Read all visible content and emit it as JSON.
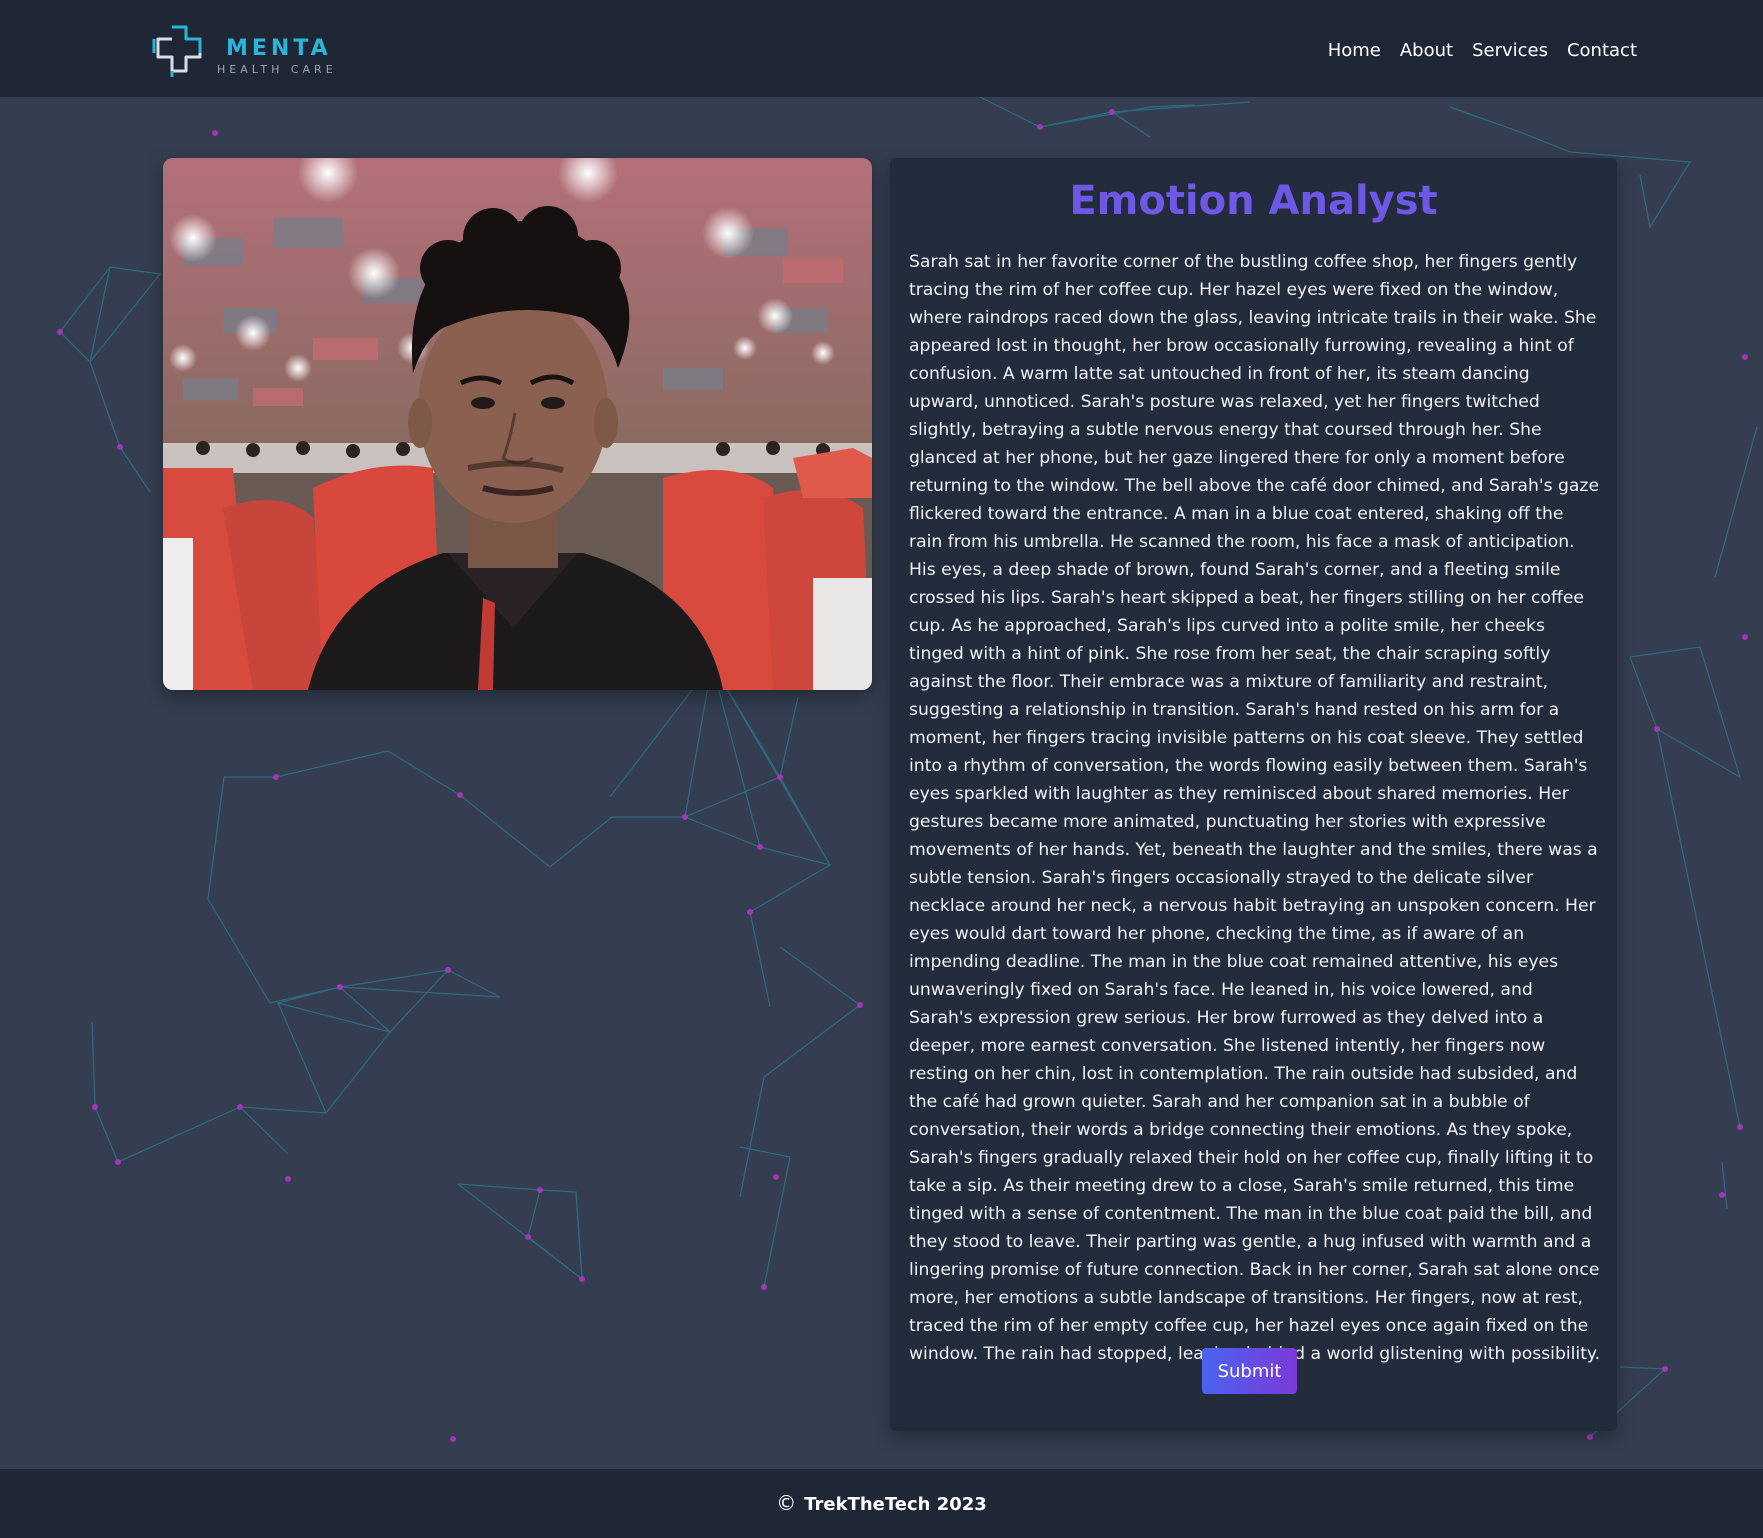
{
  "header": {
    "logo": {
      "title": "MENTA",
      "subtitle": "HEALTH CARE",
      "icon": "medical-cross-icon"
    },
    "nav": [
      {
        "label": "Home"
      },
      {
        "label": "About"
      },
      {
        "label": "Services"
      },
      {
        "label": "Contact"
      }
    ]
  },
  "photo": {
    "description_icon": "webcam-photo"
  },
  "card": {
    "title": "Emotion Analyst",
    "text": "Sarah sat in her favorite corner of the bustling coffee shop, her fingers gently tracing the rim of her coffee cup. Her hazel eyes were fixed on the window, where raindrops raced down the glass, leaving intricate trails in their wake. She appeared lost in thought, her brow occasionally furrowing, revealing a hint of confusion. A warm latte sat untouched in front of her, its steam dancing upward, unnoticed. Sarah's posture was relaxed, yet her fingers twitched slightly, betraying a subtle nervous energy that coursed through her. She glanced at her phone, but her gaze lingered there for only a moment before returning to the window. The bell above the café door chimed, and Sarah's gaze flickered toward the entrance. A man in a blue coat entered, shaking off the rain from his umbrella. He scanned the room, his face a mask of anticipation. His eyes, a deep shade of brown, found Sarah's corner, and a fleeting smile crossed his lips. Sarah's heart skipped a beat, her fingers stilling on her coffee cup. As he approached, Sarah's lips curved into a polite smile, her cheeks tinged with a hint of pink. She rose from her seat, the chair scraping softly against the floor. Their embrace was a mixture of familiarity and restraint, suggesting a relationship in transition. Sarah's hand rested on his arm for a moment, her fingers tracing invisible patterns on his coat sleeve. They settled into a rhythm of conversation, the words flowing easily between them. Sarah's eyes sparkled with laughter as they reminisced about shared memories. Her gestures became more animated, punctuating her stories with expressive movements of her hands. Yet, beneath the laughter and the smiles, there was a subtle tension. Sarah's fingers occasionally strayed to the delicate silver necklace around her neck, a nervous habit betraying an unspoken concern. Her eyes would dart toward her phone, checking the time, as if aware of an impending deadline. The man in the blue coat remained attentive, his eyes unwaveringly fixed on Sarah's face. He leaned in, his voice lowered, and Sarah's expression grew serious. Her brow furrowed as they delved into a deeper, more earnest conversation. She listened intently, her fingers now resting on her chin, lost in contemplation. The rain outside had subsided, and the café had grown quieter. Sarah and her companion sat in a bubble of conversation, their words a bridge connecting their emotions. As they spoke, Sarah's fingers gradually relaxed their hold on her coffee cup, finally lifting it to take a sip. As their meeting drew to a close, Sarah's smile returned, this time tinged with a sense of contentment. The man in the blue coat paid the bill, and they stood to leave. Their parting was gentle, a hug infused with warmth and a lingering promise of future connection. Back in her corner, Sarah sat alone once more, her emotions a subtle landscape of transitions. Her fingers, now at rest, traced the rim of her empty coffee cup, her hazel eyes once again fixed on the window. The rain had stopped, leaving behind a world glistening with possibility.",
    "submit_label": "Submit"
  },
  "footer": {
    "copyright_symbol": "©",
    "text": "TrekTheTech 2023"
  },
  "colors": {
    "brand": "#29b6d9",
    "title": "#6e59e6",
    "button_start": "#4a63f0",
    "button_end": "#7b3ad9",
    "nav_bg": "#1f2737",
    "page_bg": "#343e50",
    "card_bg": "#232c3c"
  }
}
